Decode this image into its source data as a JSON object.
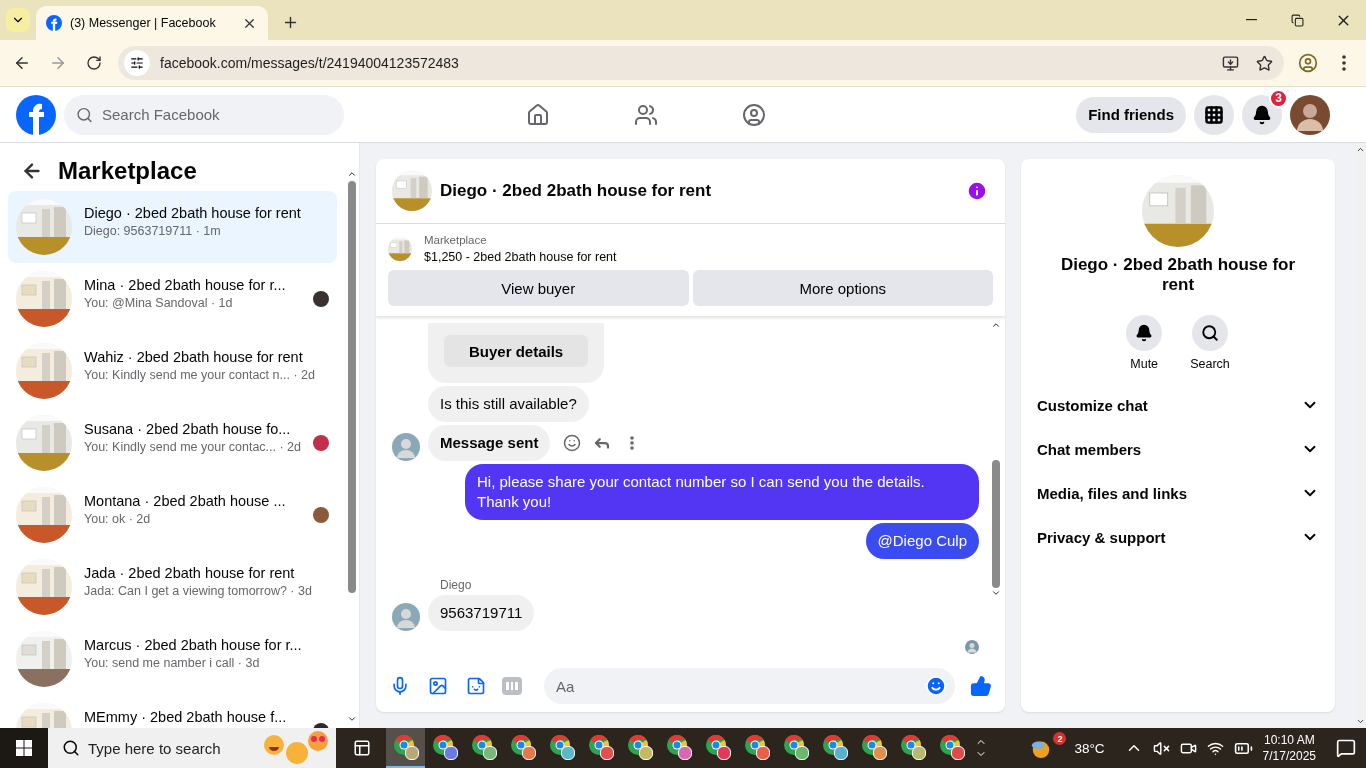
{
  "browser": {
    "tab_title": "(3) Messenger | Facebook",
    "url": "facebook.com/messages/t/24194004123572483"
  },
  "header": {
    "search_placeholder": "Search Facebook",
    "find_friends": "Find friends",
    "notification_count": "3"
  },
  "sidebar": {
    "title": "Marketplace",
    "conversations": [
      {
        "name": "Diego · 2bed 2bath house for rent",
        "snippet": "Diego: 9563719711 · 1m",
        "selected": true,
        "seen": false
      },
      {
        "name": "Mina · 2bed 2bath house for r...",
        "snippet": "You: @Mina Sandoval · 1d",
        "selected": false,
        "seen": true,
        "color": "#3a3030"
      },
      {
        "name": "Wahiz · 2bed 2bath house for rent",
        "snippet": "You: Kindly send me your contact n... · 2d",
        "selected": false,
        "seen": false
      },
      {
        "name": "Susana · 2bed 2bath house fo...",
        "snippet": "You: Kindly send me your contac... · 2d",
        "selected": false,
        "seen": true,
        "color": "#c0304a"
      },
      {
        "name": "Montana · 2bed 2bath house ...",
        "snippet": "You: ok · 2d",
        "selected": false,
        "seen": true,
        "color": "#8a5a3a"
      },
      {
        "name": "Jada · 2bed 2bath house for rent",
        "snippet": "Jada: Can I get a viewing tomorrow? · 3d",
        "selected": false,
        "seen": false
      },
      {
        "name": "Marcus · 2bed 2bath house for r...",
        "snippet": "You: send me namber i call · 3d",
        "selected": false,
        "seen": false
      },
      {
        "name": "MEmmy · 2bed 2bath house f...",
        "selected": false,
        "seen": true,
        "color": "#2a2a2a"
      }
    ]
  },
  "chat": {
    "title": "Diego · 2bed 2bath house for rent",
    "listing": {
      "label": "Marketplace",
      "text": "$1,250 - 2bed 2bath house for rent"
    },
    "buttons": [
      "View buyer",
      "More options"
    ],
    "messages": [
      {
        "kind": "card",
        "button": "Buyer details"
      },
      {
        "kind": "incoming",
        "text": "Is this still available?",
        "bold": false,
        "avatar": false,
        "actions": false
      },
      {
        "kind": "incoming",
        "text": "Message sent",
        "bold": true,
        "avatar": true,
        "actions": true
      },
      {
        "kind": "outgoing",
        "text": "Hi, please share your contact number so I can send you the details. Thank you!",
        "color": "#5236f4"
      },
      {
        "kind": "outgoing",
        "text": "@Diego Culp",
        "color": "#3a4cf0"
      },
      {
        "kind": "sender",
        "text": "Diego"
      },
      {
        "kind": "incoming",
        "text": "9563719711",
        "bold": false,
        "avatar": true,
        "actions": false
      }
    ],
    "composer_placeholder": "Aa"
  },
  "details": {
    "title": "Diego · 2bed 2bath house for rent",
    "actions": [
      {
        "kind": "mute",
        "label": "Mute"
      },
      {
        "kind": "search",
        "label": "Search"
      }
    ],
    "sections": [
      "Customize chat",
      "Chat members",
      "Media, files and links",
      "Privacy & support"
    ]
  },
  "taskbar": {
    "search_placeholder": "Type here to search",
    "apps": [
      {
        "selected": true,
        "color": "#b8a878"
      },
      {
        "selected": false,
        "color": "#6a7ae0"
      },
      {
        "selected": false,
        "color": "#7ab87a"
      },
      {
        "selected": false,
        "color": "#e07a4a"
      },
      {
        "selected": false,
        "color": "#5ab8c8"
      },
      {
        "selected": false,
        "color": "#e05050"
      },
      {
        "selected": false,
        "color": "#c8b860"
      },
      {
        "selected": false,
        "color": "#d868b0"
      },
      {
        "selected": false,
        "color": "#e03a5a"
      },
      {
        "selected": false,
        "color": "#e8604a"
      },
      {
        "selected": false,
        "color": "#6ab86a"
      },
      {
        "selected": false,
        "color": "#5ab0d0"
      },
      {
        "selected": false,
        "color": "#e0904a"
      },
      {
        "selected": false,
        "color": "#b8b870"
      },
      {
        "selected": false,
        "color": "#e04a4a"
      }
    ],
    "weather_badge": "2",
    "temperature": "38°C",
    "time": "10:10 AM",
    "date": "7/17/2025"
  }
}
